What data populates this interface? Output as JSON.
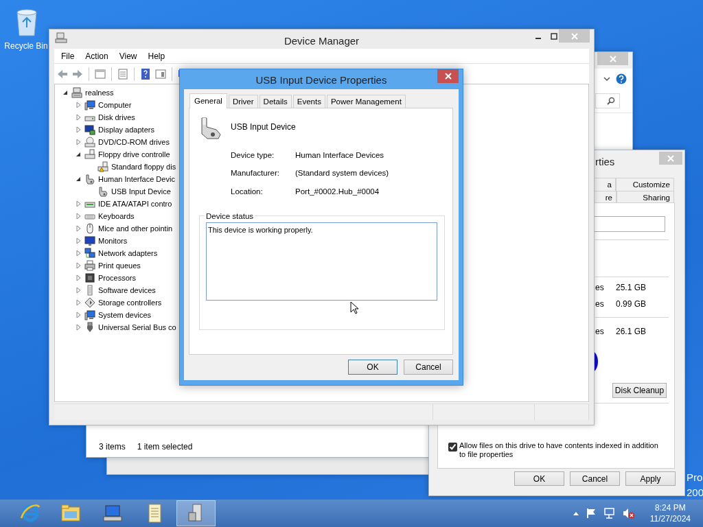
{
  "desktop": {
    "icons": [
      {
        "label": "Recycle Bin"
      }
    ],
    "edition_lines": [
      "Pro",
      "200"
    ]
  },
  "explorer_window": {
    "status_items": [
      "3 items",
      "1 item selected"
    ]
  },
  "drive_properties": {
    "title": "rties",
    "tab_rows": [
      [
        {
          "label": "a",
          "selected": false
        },
        {
          "label": "Customize",
          "selected": false
        }
      ],
      [
        {
          "label": "re",
          "selected": false
        },
        {
          "label": "Sharing",
          "selected": false
        }
      ]
    ],
    "space_rows": [
      {
        "label": "es",
        "value": "25.1 GB"
      },
      {
        "label": "es",
        "value": "0.99 GB"
      },
      {
        "label": "es",
        "value": "26.1 GB"
      }
    ],
    "cleanup_button": "Disk Cleanup",
    "index_option": {
      "label": "Allow files on this drive to have contents indexed in addition to file properties",
      "checked": true
    },
    "buttons": [
      "OK",
      "Cancel",
      "Apply"
    ]
  },
  "device_manager": {
    "title": "Device Manager",
    "menu": [
      "File",
      "Action",
      "View",
      "Help"
    ],
    "tree": {
      "label": "realness",
      "expanded": true,
      "children": [
        {
          "label": "Computer",
          "expanded": false
        },
        {
          "label": "Disk drives",
          "expanded": false
        },
        {
          "label": "Display adapters",
          "expanded": false
        },
        {
          "label": "DVD/CD-ROM drives",
          "expanded": false
        },
        {
          "label": "Floppy drive controlle",
          "expanded": true,
          "children": [
            {
              "label": "Standard floppy dis"
            }
          ]
        },
        {
          "label": "Human Interface Devic",
          "expanded": true,
          "children": [
            {
              "label": "USB Input Device"
            }
          ]
        },
        {
          "label": "IDE ATA/ATAPI contro",
          "expanded": false
        },
        {
          "label": "Keyboards",
          "expanded": false
        },
        {
          "label": "Mice and other pointin",
          "expanded": false
        },
        {
          "label": "Monitors",
          "expanded": false
        },
        {
          "label": "Network adapters",
          "expanded": false
        },
        {
          "label": "Print queues",
          "expanded": false
        },
        {
          "label": "Processors",
          "expanded": false
        },
        {
          "label": "Software devices",
          "expanded": false
        },
        {
          "label": "Storage controllers",
          "expanded": false
        },
        {
          "label": "System devices",
          "expanded": false
        },
        {
          "label": "Universal Serial Bus co",
          "expanded": false
        }
      ]
    }
  },
  "properties_dialog": {
    "title": "USB Input Device Properties",
    "tabs": [
      {
        "label": "General",
        "selected": true
      },
      {
        "label": "Driver",
        "selected": false
      },
      {
        "label": "Details",
        "selected": false
      },
      {
        "label": "Events",
        "selected": false
      },
      {
        "label": "Power Management",
        "selected": false
      }
    ],
    "device_name": "USB Input Device",
    "info": [
      {
        "label": "Device type:",
        "value": "Human Interface Devices"
      },
      {
        "label": "Manufacturer:",
        "value": "(Standard system devices)"
      },
      {
        "label": "Location:",
        "value": "Port_#0002.Hub_#0004"
      }
    ],
    "status_group": {
      "legend": "Device status",
      "text": "This device is working properly."
    },
    "buttons": [
      "OK",
      "Cancel"
    ]
  },
  "taskbar": {
    "apps": [
      {
        "active": false
      },
      {
        "active": false
      },
      {
        "active": false
      },
      {
        "active": false
      },
      {
        "active": true
      }
    ],
    "clock": {
      "time": "8:24 PM",
      "date": "11/27/2024"
    }
  }
}
